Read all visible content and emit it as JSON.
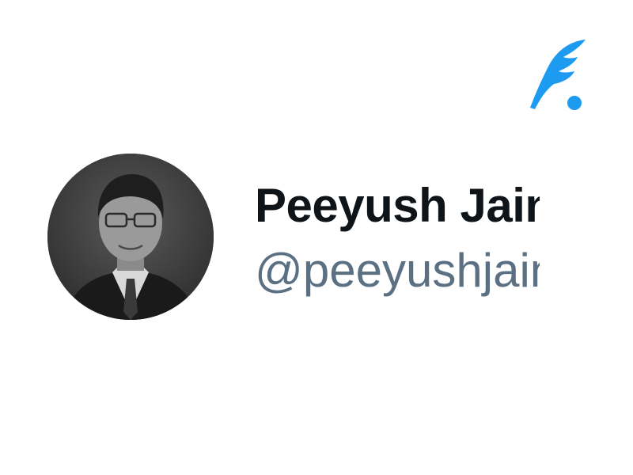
{
  "profile": {
    "display_name": "Peeyush Jain",
    "handle": "@peeyushjain"
  },
  "logo": {
    "icon": "quill-feather-icon",
    "color": "#1d9bf0"
  },
  "avatar": {
    "description": "black-and-white headshot",
    "style": "grayscale"
  },
  "colors": {
    "name_text": "#0f1419",
    "handle_text": "#5b7083",
    "accent": "#1d9bf0"
  }
}
